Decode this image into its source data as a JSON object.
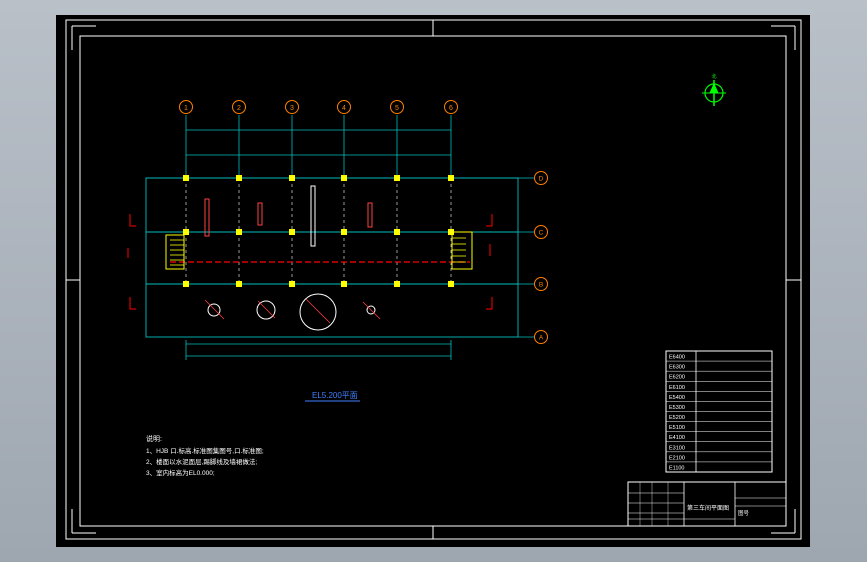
{
  "drawing": {
    "plan_title": "EL5.200平面",
    "notes_title": "说明:",
    "notes": [
      "1、HJB 口.标高.标准图集图号,口.标准图;",
      "2、楼面以水泥面层,踢脚线及墙裙做法;",
      "3、室内标高为EL0.000;"
    ],
    "axis_top": [
      "1",
      "2",
      "3",
      "4",
      "5",
      "6"
    ],
    "axis_right": [
      "D",
      "C",
      "B",
      "A"
    ],
    "compass_label": "北",
    "legend_codes": [
      "E6400",
      "E6300",
      "E6200",
      "E6100",
      "E5400",
      "E5300",
      "E5200",
      "E5100",
      "E4100",
      "E3100",
      "E2100",
      "E1100"
    ],
    "title_block": {
      "drawing_name": "第三车间平面图",
      "sheet": "图号"
    }
  },
  "colors": {
    "background": "#000000",
    "frame": "#ffffff",
    "axis": "#00c0c0",
    "bubble": "#ff8000",
    "column": "#ffff00",
    "red": "#ff0000",
    "title": "#4080ff",
    "note_text": "#ffffff",
    "compass": "#00ff00",
    "equipment": "#ff4040"
  }
}
